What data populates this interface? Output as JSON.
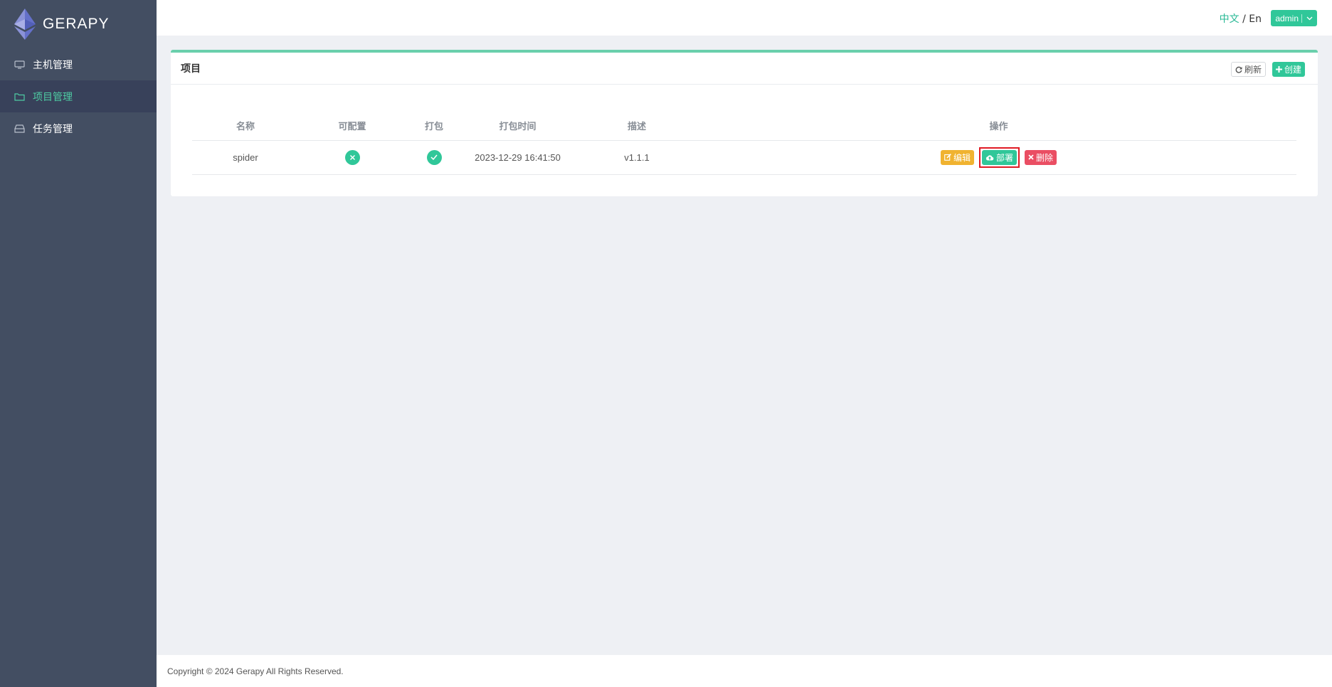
{
  "brand": {
    "name": "GERAPY"
  },
  "sidebar": {
    "items": [
      {
        "label": "主机管理",
        "icon": "monitor-icon",
        "active": false
      },
      {
        "label": "项目管理",
        "icon": "folder-icon",
        "active": true
      },
      {
        "label": "任务管理",
        "icon": "inbox-icon",
        "active": false
      }
    ]
  },
  "topbar": {
    "lang_zh": "中文",
    "lang_sep": " / ",
    "lang_en": "En",
    "user": "admin"
  },
  "card": {
    "title": "项目",
    "refresh_label": "刷新",
    "create_label": "创建"
  },
  "table": {
    "columns": [
      "名称",
      "可配置",
      "打包",
      "打包时间",
      "描述",
      "操作"
    ],
    "rows": [
      {
        "name": "spider",
        "configurable": false,
        "packaged": true,
        "built_at": "2023-12-29 16:41:50",
        "description": "v1.1.1",
        "actions": {
          "edit": "编辑",
          "deploy": "部署",
          "delete": "删除"
        }
      }
    ]
  },
  "footer": {
    "copyright": "Copyright © 2024 Gerapy All Rights Reserved."
  },
  "colors": {
    "accent": "#30c799",
    "sidebar_bg": "#434e62",
    "edit": "#f0b330",
    "delete": "#ea4e63",
    "highlight_border": "#e01b24"
  }
}
